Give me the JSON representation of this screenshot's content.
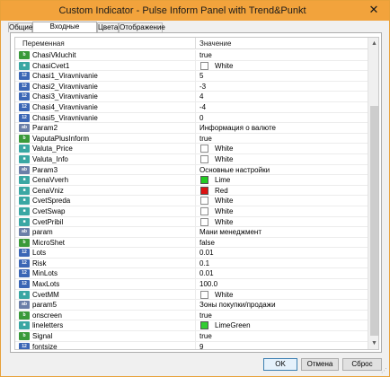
{
  "window": {
    "title": "Custom Indicator - Pulse Inform Panel with Trend&Punkt",
    "close_glyph": "✕"
  },
  "tabs": [
    {
      "label": "Общие",
      "active": false
    },
    {
      "label": "Входные параметры",
      "active": true
    },
    {
      "label": "Цвета",
      "active": false
    },
    {
      "label": "Отображение",
      "active": false
    }
  ],
  "grid": {
    "col_name": "Переменная",
    "col_value": "Значение"
  },
  "rows": [
    {
      "icon": "bool-icon",
      "name": "ChasiVkluchit",
      "value": "true",
      "kind": "text"
    },
    {
      "icon": "color-icon",
      "name": "ChasiCvet1",
      "value": "White",
      "kind": "checkbox"
    },
    {
      "icon": "num-icon",
      "name": "Chasi1_Viravnivanie",
      "value": "5",
      "kind": "text"
    },
    {
      "icon": "num-icon",
      "name": "Chasi2_Viravnivanie",
      "value": "-3",
      "kind": "text"
    },
    {
      "icon": "num-icon",
      "name": "Chasi3_Viravnivanie",
      "value": "4",
      "kind": "text"
    },
    {
      "icon": "num-icon",
      "name": "Chasi4_Viravnivanie",
      "value": "-4",
      "kind": "text"
    },
    {
      "icon": "num-icon",
      "name": "Chasi5_Viravnivanie",
      "value": "0",
      "kind": "text"
    },
    {
      "icon": "str-icon",
      "name": "Param2",
      "value": "Информация о валюте",
      "kind": "text"
    },
    {
      "icon": "bool-icon",
      "name": "VaputaPlusInform",
      "value": "true",
      "kind": "text"
    },
    {
      "icon": "color-icon",
      "name": "Valuta_Price",
      "value": "White",
      "kind": "checkbox"
    },
    {
      "icon": "color-icon",
      "name": "Valuta_Info",
      "value": "White",
      "kind": "checkbox"
    },
    {
      "icon": "str-icon",
      "name": "Param3",
      "value": "Основные настройки",
      "kind": "text"
    },
    {
      "icon": "color-icon",
      "name": "CenaVverh",
      "value": "Lime",
      "kind": "swatch",
      "color": "#22cc22"
    },
    {
      "icon": "color-icon",
      "name": "CenaVniz",
      "value": "Red",
      "kind": "swatch",
      "color": "#dd1111"
    },
    {
      "icon": "color-icon",
      "name": "CvetSpreda",
      "value": "White",
      "kind": "checkbox"
    },
    {
      "icon": "color-icon",
      "name": "CvetSwap",
      "value": "White",
      "kind": "checkbox"
    },
    {
      "icon": "color-icon",
      "name": "CvetPribil",
      "value": "White",
      "kind": "checkbox"
    },
    {
      "icon": "str-icon",
      "name": "param",
      "value": "Мани менеджмент",
      "kind": "text"
    },
    {
      "icon": "bool-icon",
      "name": "MicroShet",
      "value": "false",
      "kind": "text"
    },
    {
      "icon": "num-icon",
      "name": "Lots",
      "value": "0.01",
      "kind": "text"
    },
    {
      "icon": "num-icon",
      "name": "Risk",
      "value": "0.1",
      "kind": "text"
    },
    {
      "icon": "num-icon",
      "name": "MinLots",
      "value": "0.01",
      "kind": "text"
    },
    {
      "icon": "num-icon",
      "name": "MaxLots",
      "value": "100.0",
      "kind": "text"
    },
    {
      "icon": "color-icon",
      "name": "CvetMM",
      "value": "White",
      "kind": "checkbox"
    },
    {
      "icon": "str-icon",
      "name": "param5",
      "value": "Зоны покупки/продажи",
      "kind": "text"
    },
    {
      "icon": "bool-icon",
      "name": "onscreen",
      "value": "true",
      "kind": "text"
    },
    {
      "icon": "color-icon",
      "name": "lineletters",
      "value": "LimeGreen",
      "kind": "swatch",
      "color": "#32cd32"
    },
    {
      "icon": "bool-icon",
      "name": "Signal",
      "value": "true",
      "kind": "text"
    },
    {
      "icon": "num-icon",
      "name": "fontsize",
      "value": "9",
      "kind": "text"
    }
  ],
  "buttons": {
    "ok": "OK",
    "cancel": "Отмена",
    "reset": "Сброс"
  }
}
